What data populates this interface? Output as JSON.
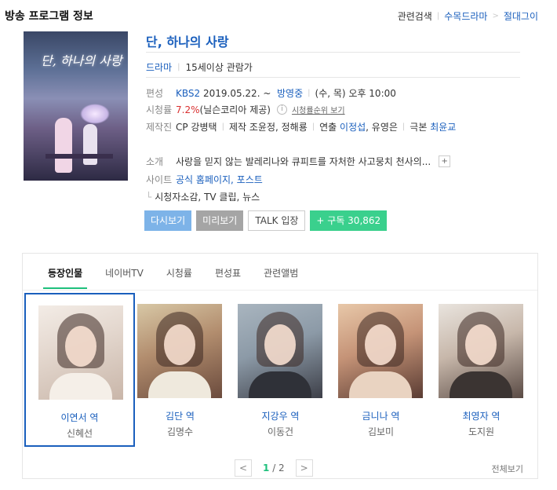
{
  "header": {
    "title": "방송 프로그램 정보",
    "links": [
      "관련검색",
      "수목드라마",
      "절대그이"
    ]
  },
  "program": {
    "poster_text": "단, 하나의 사랑",
    "title": "단, 하나의 사랑",
    "genre": "드라마",
    "rating": "15세이상 관람가",
    "schedule": {
      "label": "편성",
      "channel": "KBS2",
      "date": "2019.05.22. ~",
      "status": "방영중",
      "time": "(수, 목) 오후 10:00"
    },
    "viewership": {
      "label": "시청률",
      "value": "7.2%",
      "source": "(닐슨코리아 제공)",
      "link": "시청률순위 보기"
    },
    "crew": {
      "label": "제작진",
      "cp": "CP 강병택",
      "producer_prefix": "제작",
      "producers": "조윤정, 정해룡",
      "director_prefix": "연출",
      "director_link": "이정섭",
      "director_rest": ", 유영은",
      "writer_prefix": "극본",
      "writer": "최윤교"
    },
    "intro": {
      "label": "소개",
      "text": "사랑을 믿지 않는 발레리나와 큐피트를 자처한 사고뭉치 천사의..."
    },
    "site": {
      "label": "사이트",
      "links": "공식 홈페이지, 포스트"
    },
    "sub_links": "시청자소감, TV 클립, 뉴스"
  },
  "buttons": {
    "replay": "다시보기",
    "preview": "미리보기",
    "talk": "TALK 입장",
    "subscribe": "+ 구독 30,862"
  },
  "tabs": [
    "등장인물",
    "네이버TV",
    "시청률",
    "편성표",
    "관련앨범"
  ],
  "cast": [
    {
      "role": "이연서 역",
      "actor": "신혜선"
    },
    {
      "role": "김단 역",
      "actor": "김명수"
    },
    {
      "role": "지강우 역",
      "actor": "이동건"
    },
    {
      "role": "금니나 역",
      "actor": "김보미"
    },
    {
      "role": "최영자 역",
      "actor": "도지원"
    }
  ],
  "pager": {
    "current": "1",
    "total": "/ 2",
    "prev": "<",
    "next": ">",
    "view_all": "전체보기"
  }
}
